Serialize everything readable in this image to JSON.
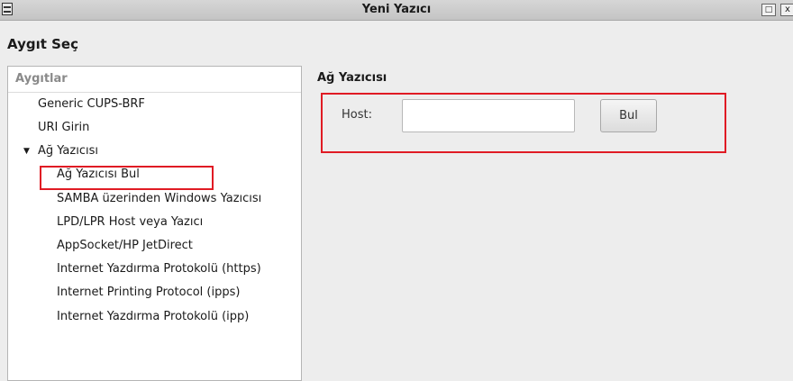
{
  "window": {
    "title": "Yeni Yazıcı",
    "maximize_glyph": "□",
    "close_glyph": "x"
  },
  "section_title": "Aygıt Seç",
  "devices": {
    "header": "Aygıtlar",
    "items": [
      {
        "label": "Generic CUPS-BRF"
      },
      {
        "label": "URI Girin"
      },
      {
        "label": "Ağ Yazıcısı",
        "expander": "▼"
      },
      {
        "label": "Ağ Yazıcısı Bul",
        "selected": true
      },
      {
        "label": "SAMBA üzerinden Windows Yazıcısı"
      },
      {
        "label": "LPD/LPR Host veya Yazıcı"
      },
      {
        "label": "AppSocket/HP JetDirect"
      },
      {
        "label": "Internet Yazdırma Protokolü (https)"
      },
      {
        "label": "Internet Printing Protocol (ipps)"
      },
      {
        "label": "Internet Yazdırma Protokolü (ipp)"
      }
    ]
  },
  "network_printer": {
    "title": "Ağ Yazıcısı",
    "host_label": "Host:",
    "host_value": "",
    "find_button": "Bul"
  },
  "colors": {
    "highlight": "#e01b24",
    "background": "#ededed"
  }
}
